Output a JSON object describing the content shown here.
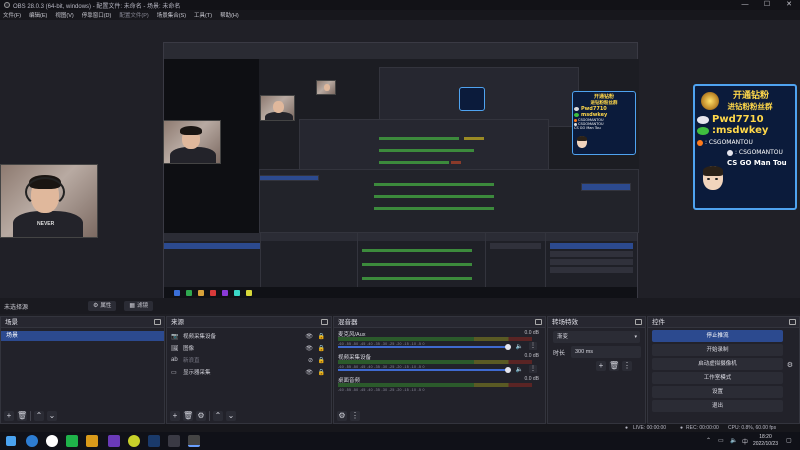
{
  "window": {
    "title": "OBS 28.0.3 (64-bit, windows) - 配置文件: 未命名 - 场景: 未命名",
    "controls": [
      "—",
      "☐",
      "✕"
    ]
  },
  "menu": [
    "文件(F)",
    "编辑(E)",
    "视图(V)",
    "停靠窗口(D)",
    "配置文件(P)",
    "场景集合(S)",
    "工具(T)",
    "帮助(H)"
  ],
  "preview": {
    "promo_large": {
      "line1": "开通钻粉",
      "line2": "进钻粉粉丝群",
      "qq": "Pwd7710",
      "wechat": ":msdwkey",
      "kuaishou": ": CSGOMANTOU",
      "douyin": ": CSGOMANTOU",
      "footer": "CS GO Man Tou"
    },
    "promo_small": {
      "line1": "开通钻粉",
      "line2": "进钻粉粉丝群",
      "qq": "Pwd7710",
      "wechat": "msdwkey",
      "kuaishou": "CSGOMANTOU",
      "douyin": "CSGOMANTOU",
      "footer": "CS GO Man Tou"
    },
    "webcam_logo": "NEVER"
  },
  "scene_bar": {
    "label": "未选择源",
    "properties": "属性",
    "filters": "滤镜"
  },
  "scenes": {
    "title": "场景",
    "items": [
      "场景"
    ]
  },
  "sources": {
    "title": "来源",
    "items": [
      {
        "icon": "camera-icon",
        "name": "视频采集设备",
        "dim": false
      },
      {
        "icon": "image-icon",
        "name": "图像",
        "dim": false
      },
      {
        "icon": "text-icon",
        "name": "新浪直",
        "dim": true
      },
      {
        "icon": "monitor-icon",
        "name": "显示器采集",
        "dim": false
      }
    ]
  },
  "mixer": {
    "title": "混音器",
    "ticks": "-60  -55  -50  -45  -40  -35  -30  -25  -20  -15  -10  -5  0",
    "channels": [
      {
        "name": "麦克风/Aux",
        "db": "0.0 dB",
        "level": 0.0
      },
      {
        "name": "视频采集设备",
        "db": "0.0 dB",
        "level": 0.0
      },
      {
        "name": "桌面音频",
        "db": "0.0 dB",
        "level": 0.0
      }
    ]
  },
  "transitions": {
    "title": "转场特效",
    "type": "渐变",
    "duration_label": "时长",
    "duration": "300 ms"
  },
  "controls": {
    "title": "控件",
    "buttons": [
      "停止推流",
      "开始录制",
      "启动虚拟摄像机",
      "工作室模式",
      "设置",
      "退出"
    ]
  },
  "status": {
    "live": "LIVE: 00:00:00",
    "rec": "REC: 00:00:00",
    "cpu": "CPU: 0.8%, 60.00 fps"
  },
  "taskbar": {
    "time": "18:20",
    "date": "2022/10/23"
  }
}
